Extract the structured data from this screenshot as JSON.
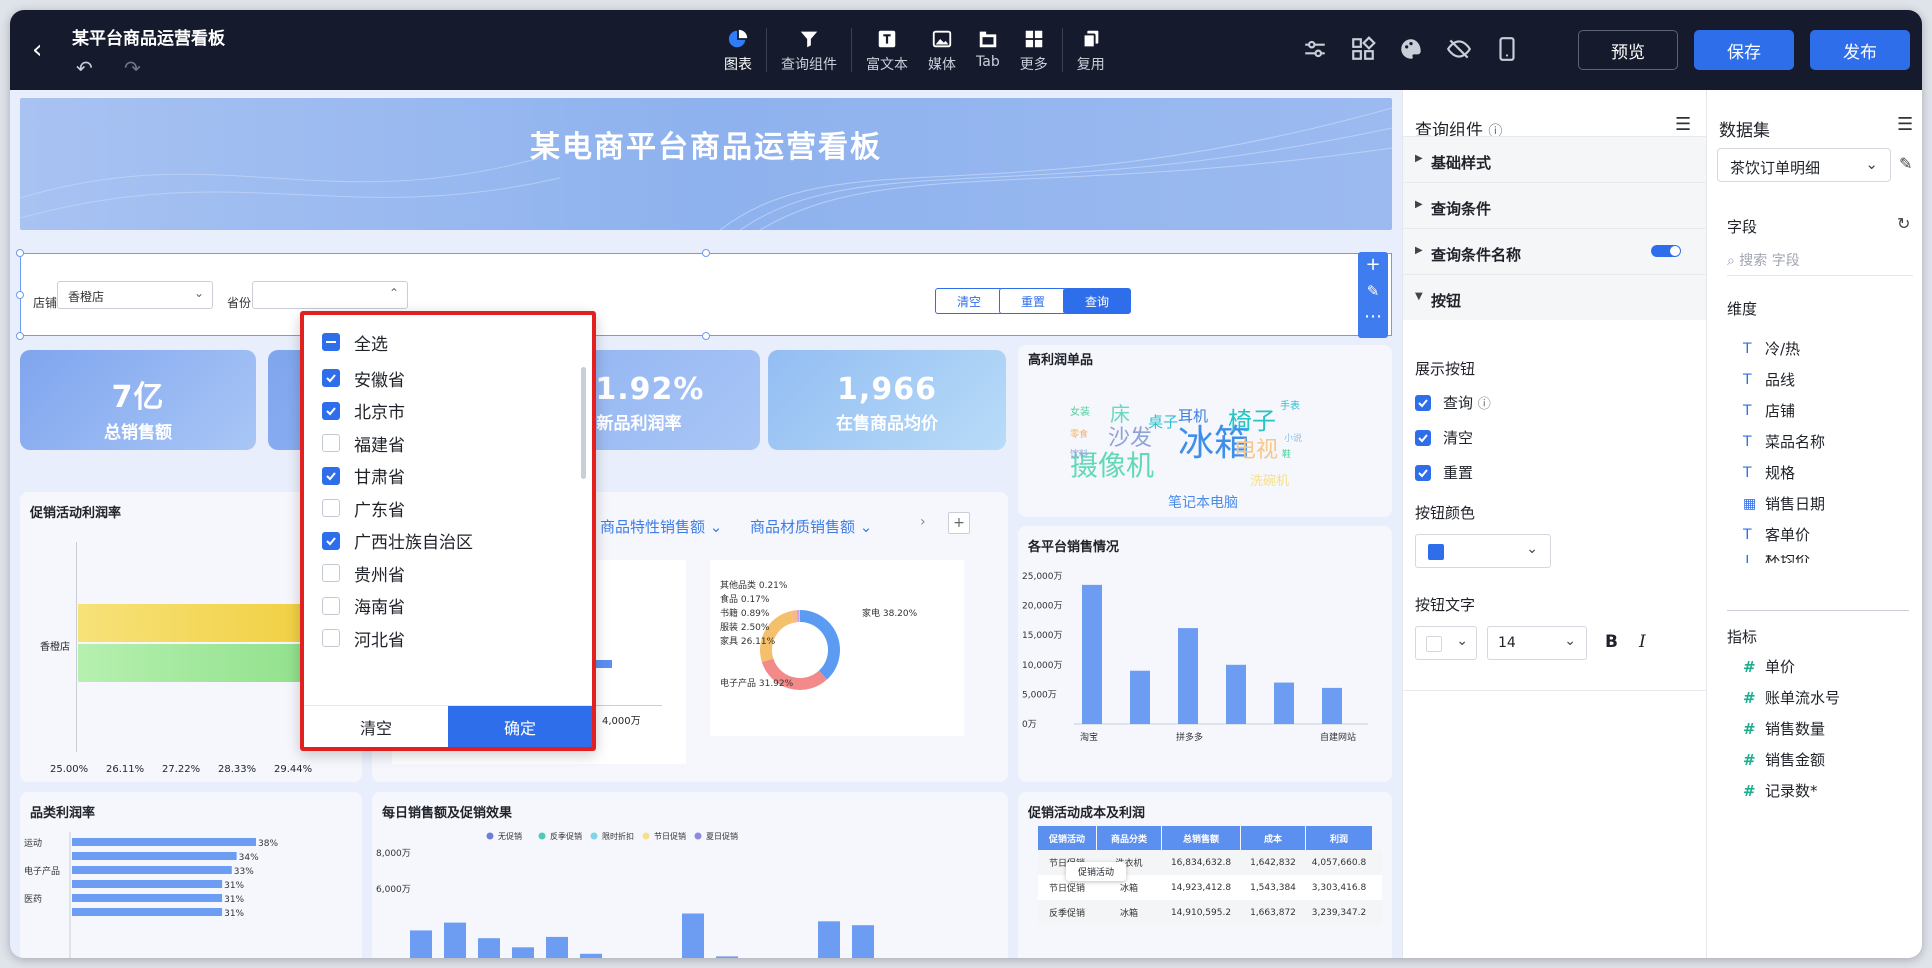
{
  "topbar": {
    "title": "某平台商品运营看板",
    "tools": [
      {
        "label": "图表",
        "icon": "pie-chart-icon"
      },
      {
        "label": "查询组件",
        "icon": "filter-icon"
      },
      {
        "label": "富文本",
        "icon": "text-icon"
      },
      {
        "label": "媒体",
        "icon": "image-icon"
      },
      {
        "label": "Tab",
        "icon": "tab-icon"
      },
      {
        "label": "更多",
        "icon": "grid-icon"
      },
      {
        "label": "复用",
        "icon": "copy-icon"
      }
    ],
    "preview": "预览",
    "save": "保存",
    "publish": "发布"
  },
  "banner": {
    "title": "某电商平台商品运营看板"
  },
  "query": {
    "shop_label": "店铺",
    "shop_value": "香橙店",
    "province_label": "省份",
    "clear": "清空",
    "reset": "重置",
    "search": "查询"
  },
  "kpis": [
    {
      "value": "7亿",
      "label": "总销售额"
    },
    {
      "value": "31.92%",
      "label": "新品利润率"
    },
    {
      "value": "1,966",
      "label": "在售商品均价"
    }
  ],
  "dropdown": {
    "all": "全选",
    "items": [
      {
        "label": "安徽省",
        "checked": true
      },
      {
        "label": "北京市",
        "checked": true
      },
      {
        "label": "福建省",
        "checked": false
      },
      {
        "label": "甘肃省",
        "checked": true
      },
      {
        "label": "广东省",
        "checked": false
      },
      {
        "label": "广西壮族自治区",
        "checked": true
      },
      {
        "label": "贵州省",
        "checked": false
      },
      {
        "label": "海南省",
        "checked": false
      },
      {
        "label": "河北省",
        "checked": false
      }
    ],
    "clear": "清空",
    "confirm": "确定"
  },
  "charts": {
    "promo_margin": {
      "title": "促销活动利润率",
      "category": "香橙店",
      "ticks": [
        "25.00%",
        "26.11%",
        "27.22%",
        "28.33%",
        "29.44%"
      ]
    },
    "tabs": [
      "商品特性销售额",
      "商品材质销售额"
    ],
    "bar_axis": "4,000万",
    "donut": {
      "slices": [
        {
          "label": "其他品类 0.21%",
          "value": 0.21,
          "color": "#8ee0b0"
        },
        {
          "label": "食品 0.17%",
          "value": 0.17,
          "color": "#f5d76e"
        },
        {
          "label": "书籍 0.89%",
          "value": 0.89,
          "color": "#c7a0f0"
        },
        {
          "label": "服装 2.50%",
          "value": 2.5,
          "color": "#f7b98a"
        },
        {
          "label": "家具 26.11%",
          "value": 26.11,
          "color": "#f5c06b"
        },
        {
          "label": "电子产品 31.92%",
          "value": 31.92,
          "color": "#f28a8a"
        },
        {
          "label": "家电 38.20%",
          "value": 38.2,
          "color": "#5b9cf2"
        }
      ]
    },
    "wordcloud": {
      "title": "高利润单品",
      "words": [
        {
          "t": "冰箱",
          "c": "#3f8ee8"
        },
        {
          "t": "摄像机",
          "c": "#63d8b8"
        },
        {
          "t": "椅子",
          "c": "#27c4c4"
        },
        {
          "t": "电视",
          "c": "#f5c78a"
        },
        {
          "t": "沙发",
          "c": "#8fa2d8"
        },
        {
          "t": "床",
          "c": "#6cd6c0"
        },
        {
          "t": "桌子",
          "c": "#2fc1cf"
        },
        {
          "t": "耳机",
          "c": "#3d7ee0"
        },
        {
          "t": "笔记本电脑",
          "c": "#4b8be8"
        },
        {
          "t": "洗碗机",
          "c": "#f6e08a"
        },
        {
          "t": "女装",
          "c": "#4fcf9a"
        },
        {
          "t": "手表",
          "c": "#2fc1cf"
        },
        {
          "t": "零食",
          "c": "#f4b26b"
        },
        {
          "t": "饮料",
          "c": "#8fa2d8"
        },
        {
          "t": "小说",
          "c": "#8fc0e8"
        },
        {
          "t": "鞋",
          "c": "#4fcf9a"
        }
      ]
    },
    "platform": {
      "title": "各平台销售情况",
      "yticks": [
        "25,000万",
        "20,000万",
        "15,000万",
        "10,000万",
        "5,000万",
        "0万"
      ],
      "xlabels": [
        "淘宝",
        "拼多多",
        "自建网站"
      ]
    },
    "category_margin": {
      "title": "品类利润率",
      "rows": [
        {
          "label": "运动",
          "pct": "38%"
        },
        {
          "label": "",
          "pct": "34%"
        },
        {
          "label": "电子产品",
          "pct": "33%"
        },
        {
          "label": "",
          "pct": "31%"
        },
        {
          "label": "医药",
          "pct": "31%"
        },
        {
          "label": "",
          "pct": "31%"
        }
      ]
    },
    "daily": {
      "title": "每日销售额及促销效果",
      "legend": [
        "无促销",
        "反季促销",
        "限时折扣",
        "节日促销",
        "夏日促销"
      ],
      "yticks": [
        "8,000万",
        "6,000万"
      ]
    },
    "promo_cost": {
      "title": "促销活动成本及利润",
      "headers": [
        "促销活动",
        "商品分类",
        "总销售额",
        "成本",
        "利润"
      ],
      "tooltip": "促销活动",
      "rows": [
        [
          "节日促销",
          "洗衣机",
          "16,834,632.8",
          "1,642,832",
          "4,057,660.8"
        ],
        [
          "节日促销",
          "冰箱",
          "14,923,412.8",
          "1,543,384",
          "3,303,416.8"
        ],
        [
          "反季促销",
          "冰箱",
          "14,910,595.2",
          "1,663,872",
          "3,239,347.2"
        ]
      ]
    }
  },
  "chart_data": [
    {
      "type": "bar",
      "title": "各平台销售情况",
      "categories": [
        "淘宝",
        "",
        "拼多多",
        "",
        "",
        "自建网站"
      ],
      "values": [
        23500,
        9000,
        16200,
        10000,
        7000,
        6100
      ],
      "ylim": [
        0,
        25000
      ]
    },
    {
      "type": "bar",
      "title": "品类利润率",
      "categories": [
        "运动",
        "",
        "电子产品",
        "",
        "医药",
        ""
      ],
      "values": [
        38,
        34,
        33,
        31,
        31,
        31
      ]
    },
    {
      "type": "pie",
      "categories": [
        "家电",
        "电子产品",
        "家具",
        "服装",
        "书籍",
        "食品",
        "其他品类"
      ],
      "values": [
        38.2,
        31.92,
        26.11,
        2.5,
        0.89,
        0.17,
        0.21
      ]
    },
    {
      "type": "bar",
      "title": "每日销售额及促销效果",
      "values": [
        3.2,
        3.8,
        2.6,
        1.9,
        2.7,
        1.4,
        0,
        0,
        4.5,
        1.2,
        0,
        0,
        3.9,
        3.6
      ]
    }
  ],
  "panel": {
    "title": "查询组件",
    "sections": [
      "基础样式",
      "查询条件",
      "查询条件名称",
      "按钮"
    ],
    "show_buttons": "展示按钮",
    "buttons": [
      "查询",
      "清空",
      "重置"
    ],
    "button_color": "按钮颜色",
    "button_text": "按钮文字",
    "font_size": "14",
    "bold": "B",
    "italic": "I"
  },
  "dataset": {
    "title": "数据集",
    "selected": "茶饮订单明细",
    "fields_label": "字段",
    "search_placeholder": "搜索 字段",
    "dimensions_label": "维度",
    "dimensions": [
      "冷/热",
      "品线",
      "店铺",
      "菜品名称",
      "规格",
      "销售日期",
      "客单价",
      "杯均价"
    ],
    "measures_label": "指标",
    "measures": [
      "单价",
      "账单流水号",
      "销售数量",
      "销售金额",
      "记录数*"
    ]
  }
}
